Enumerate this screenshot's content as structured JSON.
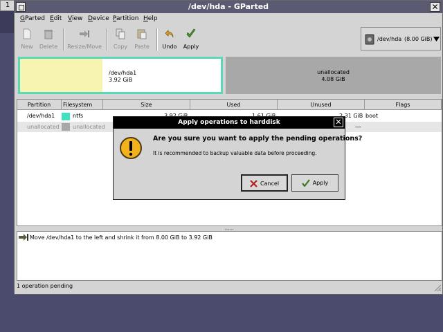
{
  "workspace": {
    "number": "1"
  },
  "window": {
    "title": "/dev/hda - GParted"
  },
  "menubar": {
    "items": [
      {
        "label": "GParted",
        "mnemonic": "G"
      },
      {
        "label": "Edit",
        "mnemonic": "E"
      },
      {
        "label": "View",
        "mnemonic": "V"
      },
      {
        "label": "Device",
        "mnemonic": "D"
      },
      {
        "label": "Partition",
        "mnemonic": "P"
      },
      {
        "label": "Help",
        "mnemonic": "H"
      }
    ]
  },
  "toolbar": {
    "new": "New",
    "delete": "Delete",
    "resize_move": "Resize/Move",
    "copy": "Copy",
    "paste": "Paste",
    "undo": "Undo",
    "apply": "Apply"
  },
  "device_selector": {
    "label": "/dev/hda",
    "size": "(8.00 GiB)"
  },
  "disk_map": {
    "partition": {
      "name": "/dev/hda1",
      "size": "3.92 GiB",
      "fill_color": "#f7f3b0",
      "border_color": "#5ad8b8",
      "used_fraction": 0.41
    },
    "unallocated": {
      "name": "unallocated",
      "size": "4.08 GiB"
    }
  },
  "partition_table": {
    "columns": [
      "Partition",
      "Filesystem",
      "Size",
      "Used",
      "Unused",
      "Flags"
    ],
    "rows": [
      {
        "partition": "/dev/hda1",
        "filesystem": "ntfs",
        "fs_color": "#40e0c0",
        "size": "3.92 GiB",
        "used": "1.61 GiB",
        "unused": "2.31 GiB",
        "flags": "boot"
      },
      {
        "partition": "unallocated",
        "filesystem": "unallocated",
        "fs_color": "#a8a8a8",
        "size": "",
        "used": "",
        "unused": "---",
        "flags": ""
      }
    ]
  },
  "pane_handle": ",,,,,,,",
  "pending_operations": [
    {
      "text": "Move /dev/hda1 to the left and shrink it from 8.00 GiB to 3.92 GiB"
    }
  ],
  "status_bar": {
    "text": "1 operation pending"
  },
  "dialog": {
    "title": "Apply operations to harddisk",
    "close_glyph": "✕",
    "primary": "Are you sure you want to apply the pending operations?",
    "secondary": "It is recommended to backup valuable data before proceeding.",
    "cancel_label": "Cancel",
    "apply_label": "Apply"
  }
}
